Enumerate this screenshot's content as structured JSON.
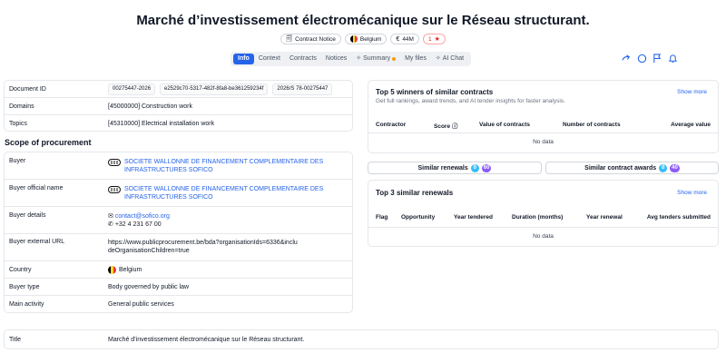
{
  "header": {
    "title": "Marché d’investissement électromécanique sur le Réseau structurant.",
    "badges": {
      "notice": "Contract Notice",
      "country": "Belgium",
      "value": "44M",
      "rating": "1"
    }
  },
  "tabs": [
    {
      "label": "Info"
    },
    {
      "label": "Context"
    },
    {
      "label": "Contracts"
    },
    {
      "label": "Notices"
    },
    {
      "label": "Summary"
    },
    {
      "label": "My files"
    },
    {
      "label": "AI Chat"
    }
  ],
  "colors": {
    "accent": "#2563eb",
    "count_blue": "#38bdf8",
    "count_purple": "#8b5cf6",
    "star": "#dc2626"
  },
  "doc": {
    "rows": [
      {
        "label": "Document ID",
        "ids": [
          "00275447-2026",
          "e2529c70-5317-482f-8fa8-be361259234f",
          "2026/S 78-00275447"
        ]
      },
      {
        "label": "Domains",
        "value": "[45000000] Construction work"
      },
      {
        "label": "Topics",
        "value": "[45310000] Electrical installation work"
      }
    ]
  },
  "scope": {
    "title": "Scope of procurement",
    "buyer": {
      "label": "Buyer",
      "value": "SOCIETE WALLONNE DE FINANCEMENT COMPLEMENTAIRE DES INFRASTRUCTURES SOFICO"
    },
    "buyer_official": {
      "label": "Buyer official name",
      "value": "SOCIETE WALLONNE DE FINANCEMENT COMPLEMENTAIRE DES INFRASTRUCTURES SOFICO"
    },
    "buyer_details": {
      "label": "Buyer details",
      "email": "contact@sofico.org",
      "phone": "+32 4 231 67 00"
    },
    "buyer_url": {
      "label": "Buyer external URL",
      "value": "https://www.publicprocurement.be/bda?organisationIds=6336&includeOrganisationChildren=true"
    },
    "country": {
      "label": "Country",
      "value": "Belgium"
    },
    "buyer_type": {
      "label": "Buyer type",
      "value": "Body governed by public law"
    },
    "main_activity": {
      "label": "Main activity",
      "value": "General public services"
    }
  },
  "winners": {
    "title": "Top 5 winners of similar contracts",
    "subtitle": "Get full rankings, award trends, and AI tender insights for faster analysis.",
    "show_more": "Show more",
    "columns": [
      "Contractor",
      "Score ⓘ",
      "Value of contracts",
      "Number of contracts",
      "Average value"
    ],
    "empty": "No data"
  },
  "similar": {
    "renewals_label": "Similar renewals",
    "renewals_a": "0",
    "renewals_b": "60",
    "awards_label": "Similar contract awards",
    "awards_a": "0",
    "awards_b": "40"
  },
  "renewals": {
    "title": "Top 3 similar renewals",
    "show_more": "Show more",
    "columns": [
      "Flag",
      "Opportunity",
      "Year tendered",
      "Duration (months)",
      "Year renewal",
      "Avg tenders submitted"
    ],
    "empty": "No data"
  },
  "bottom": {
    "label": "Title",
    "value": "Marché d’investissement électromécanique sur le Réseau structurant."
  }
}
